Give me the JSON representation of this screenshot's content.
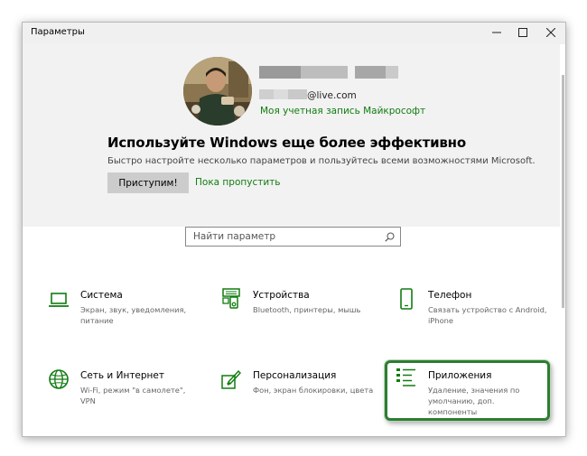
{
  "window": {
    "title": "Параметры"
  },
  "account": {
    "email_visible": "@live.com",
    "ms_account_link": "Моя учетная запись Майкрософт"
  },
  "promo": {
    "title": "Используйте Windows еще более эффективно",
    "subtitle": "Быстро настройте несколько параметров и пользуйтесь всеми возможностями Microsoft.",
    "start_button": "Приступим!",
    "skip_link": "Пока пропустить"
  },
  "search": {
    "placeholder": "Найти параметр"
  },
  "tiles": [
    {
      "name": "Система",
      "desc": "Экран, звук, уведомления, питание",
      "icon": "laptop-icon"
    },
    {
      "name": "Устройства",
      "desc": "Bluetooth, принтеры, мышь",
      "icon": "devices-icon"
    },
    {
      "name": "Телефон",
      "desc": "Связать устройство с Android, iPhone",
      "icon": "phone-icon"
    },
    {
      "name": "Сеть и Интернет",
      "desc": "Wi-Fi, режим \"в самолете\", VPN",
      "icon": "globe-icon"
    },
    {
      "name": "Персонализация",
      "desc": "Фон, экран блокировки, цвета",
      "icon": "paint-icon"
    },
    {
      "name": "Приложения",
      "desc": "Удаление, значения по умолчанию, доп. компоненты",
      "icon": "apps-list-icon"
    }
  ],
  "colors": {
    "accent_green": "#107c10",
    "highlight_border": "#2e7d32",
    "banner_bg": "#f2f2f2"
  }
}
